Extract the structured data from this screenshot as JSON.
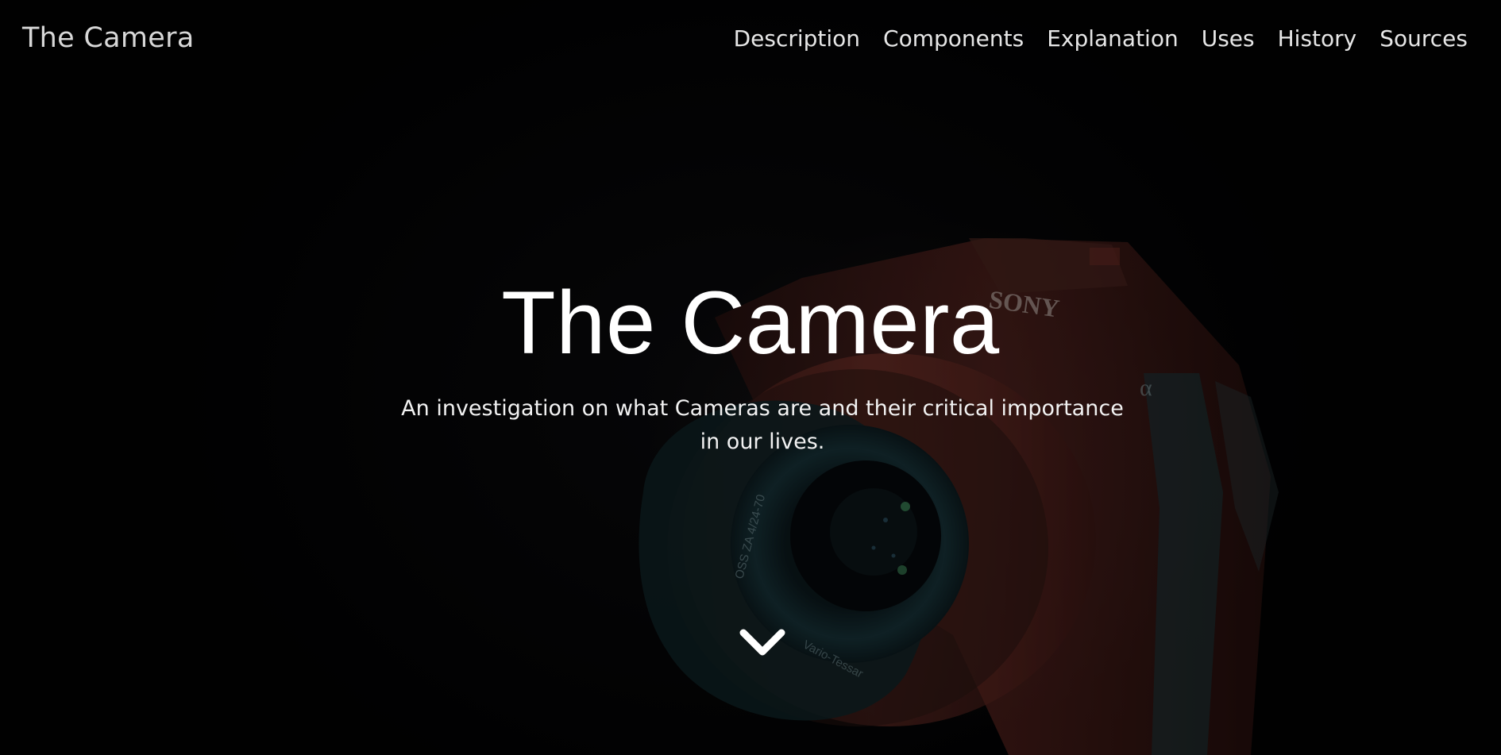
{
  "nav": {
    "brand": "The Camera",
    "links": [
      {
        "label": "Description"
      },
      {
        "label": "Components"
      },
      {
        "label": "Explanation"
      },
      {
        "label": "Uses"
      },
      {
        "label": "History"
      },
      {
        "label": "Sources"
      }
    ]
  },
  "hero": {
    "title": "The Camera",
    "subtitle": "An investigation on what Cameras are and their critical importance in our lives.",
    "background_image_brand_text": "SONY",
    "lens_text": "Vario-Tessar FE 4/24-70 ZA OSS",
    "scroll_icon": "chevron-down-icon"
  },
  "colors": {
    "background": "#050505",
    "text": "#ffffff",
    "camera_red": "#7a2f28",
    "camera_teal": "#1f4a52"
  }
}
